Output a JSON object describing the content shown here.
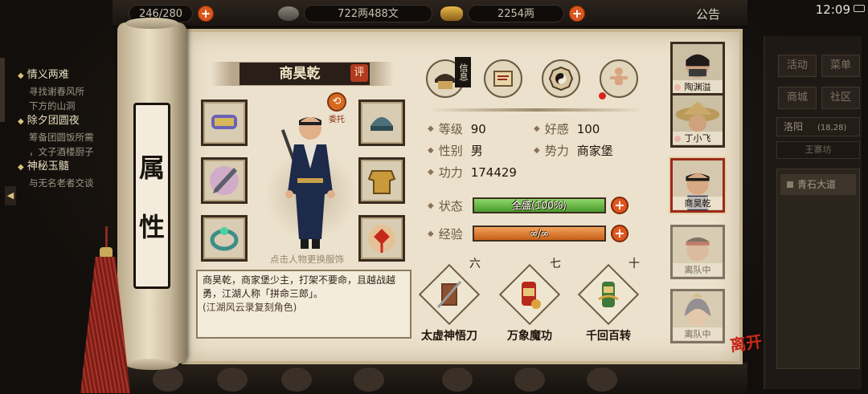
{
  "top_bar": {
    "stamina": "246/280",
    "copper": "722两488文",
    "gold": "2254两",
    "notice": "公告",
    "time": "12:09"
  },
  "quests": [
    {
      "title": "情义两难",
      "desc": [
        "寻找谢春风所",
        "下方的山洞"
      ]
    },
    {
      "title": "除夕团圆夜",
      "desc": [
        "筹备团圆饭所需",
        "，文子酒楼厨子"
      ]
    },
    {
      "title": "神秘玉髓",
      "desc": [
        "与无名老者交谈"
      ]
    }
  ],
  "side_menu": {
    "activity": "活动",
    "menu": "菜单",
    "shop": "商城",
    "community": "社区"
  },
  "location": {
    "city": "洛阳",
    "coords": "(18,28)",
    "sub": "王寨坊",
    "road": "青石大道"
  },
  "scroll_title": [
    "属",
    "性"
  ],
  "character": {
    "name": "商昊乾",
    "eval_label": "评",
    "commission_label": "委托",
    "outfit_hint": "点击人物更换服饰",
    "bio": "商昊乾，商家堡少主，打架不要命，且越战越勇，江湖人称「拼命三郎」。",
    "bio_note": "(江湖风云录复刻角色)"
  },
  "top_icons": {
    "letter": "信息",
    "letter_icon": "letter-icon",
    "scroll_icon": "scroll-icon",
    "bagua_icon": "bagua-icon",
    "meridian_icon": "meridian-icon"
  },
  "stats": {
    "level_label": "等级",
    "level": "90",
    "favor_label": "好感",
    "favor": "100",
    "gender_label": "性别",
    "gender": "男",
    "faction_label": "势力",
    "faction": "商家堡",
    "power_label": "功力",
    "power": "174429"
  },
  "bars": {
    "status_label": "状态",
    "status_text": "全盛(100%)",
    "status_ratio": 1.0,
    "exp_label": "经验",
    "exp_text": "∞/∞",
    "exp_ratio": 1.0
  },
  "skills": [
    {
      "rank": "六",
      "name": "太虚神悟刀",
      "icon": "blade-icon"
    },
    {
      "rank": "七",
      "name": "万象魔功",
      "icon": "scroll-red-icon"
    },
    {
      "rank": "十",
      "name": "千回百转",
      "icon": "scroll-green-icon"
    }
  ],
  "roster": [
    {
      "name": "陶渊溢",
      "state": "normal",
      "dot": true
    },
    {
      "name": "丁小飞",
      "state": "normal",
      "dot": true
    },
    {
      "name": "商昊乾",
      "state": "active",
      "dot": false
    },
    {
      "name": "离队中",
      "state": "faded",
      "dot": false
    },
    {
      "name": "离队中",
      "state": "faded",
      "dot": false
    }
  ],
  "leave_label": "离开",
  "colors": {
    "accent_red": "#b23b1f",
    "status_green": "#6cc04a",
    "exp_orange": "#e8823a",
    "paper": "#ece1cc"
  }
}
